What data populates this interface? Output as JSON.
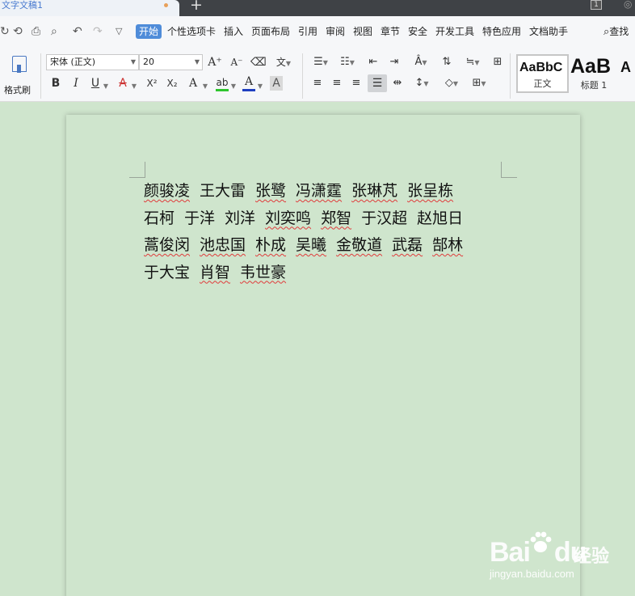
{
  "tabbar": {
    "doc_title": "文字文稿1",
    "add_tab": "+",
    "tab_count": "1"
  },
  "menu": {
    "items": [
      "开始",
      "个性选项卡",
      "插入",
      "页面布局",
      "引用",
      "审阅",
      "视图",
      "章节",
      "安全",
      "开发工具",
      "特色应用",
      "文档助手"
    ],
    "search_label": "查找"
  },
  "ribbon": {
    "format_painter": "格式刷",
    "font_name": "宋体 (正文)",
    "font_size": "20",
    "styles": [
      {
        "sample": "AaBbC",
        "label": "正文"
      },
      {
        "sample": "AaB",
        "label": "标题 1"
      },
      {
        "sample": "A",
        "label": ""
      }
    ],
    "icons": {
      "increase_font": "A⁺",
      "decrease_font": "A⁻",
      "bold": "B",
      "italic": "I",
      "underline": "U",
      "strike": "A",
      "superscript": "X²",
      "subscript": "X₂",
      "text_effect": "A",
      "highlight": "ab",
      "font_color": "A",
      "char_shading": "A"
    },
    "colors": {
      "highlight_bar": "#2ec52e",
      "font_color_bar": "#1f3fc0"
    }
  },
  "document": {
    "lines": [
      [
        "颜骏凌",
        "王大雷",
        "张鹭",
        "冯潇霆",
        "张琳芃",
        "张呈栋"
      ],
      [
        "石柯",
        "于洋",
        "刘洋",
        "刘奕鸣",
        "郑智",
        "于汉超",
        "赵旭日"
      ],
      [
        "蒿俊闵",
        "池忠国",
        "朴成",
        "吴曦",
        "金敬道",
        "武磊",
        "郜林"
      ],
      [
        "于大宝",
        "肖智",
        "韦世豪"
      ]
    ],
    "unmarked": [
      [
        1
      ],
      [
        0,
        1,
        2,
        5,
        6
      ],
      [],
      [
        0
      ]
    ]
  },
  "watermark": {
    "logo": "Bai",
    "logo_tail": "du",
    "cn": "经验",
    "url": "jingyan.baidu.com"
  }
}
